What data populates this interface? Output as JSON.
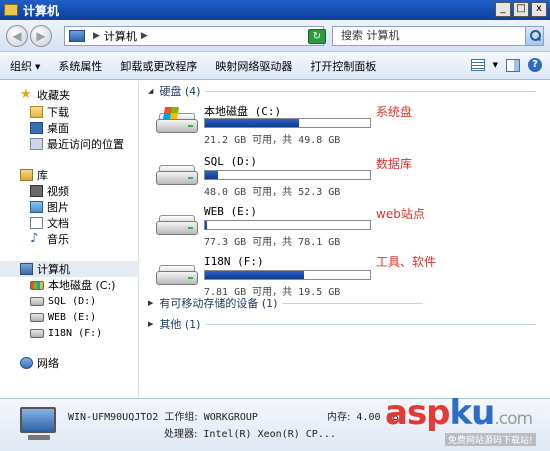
{
  "window": {
    "title": "计算机",
    "btn_min": "_",
    "btn_max": "□",
    "btn_close": "x"
  },
  "address": {
    "location": "计算机",
    "search_placeholder": "搜索 计算机"
  },
  "toolbar": {
    "organize": "组织",
    "system_properties": "系统属性",
    "uninstall": "卸载或更改程序",
    "map_drive": "映射网络驱动器",
    "control_panel": "打开控制面板"
  },
  "sidebar": {
    "favorites": "收藏夹",
    "downloads": "下载",
    "desktop": "桌面",
    "recent": "最近访问的位置",
    "libraries": "库",
    "videos": "视频",
    "pictures": "图片",
    "documents": "文档",
    "music": "音乐",
    "computer": "计算机",
    "drive_c": "本地磁盘 (C:)",
    "drive_d": "SQL (D:)",
    "drive_e": "WEB (E:)",
    "drive_f": "I18N (F:)",
    "network": "网络"
  },
  "groups": {
    "hdd": "硬盘 (4)",
    "removable": "有可移动存储的设备 (1)",
    "other": "其他 (1)"
  },
  "drives": [
    {
      "name": "本地磁盘 (C:)",
      "info": "21.2 GB 可用，共 49.8 GB",
      "used_fraction": 0.57,
      "annotation": "系统盘",
      "system": true
    },
    {
      "name": "SQL (D:)",
      "info": "48.0 GB 可用，共 52.3 GB",
      "used_fraction": 0.08,
      "annotation": "数据库",
      "system": false
    },
    {
      "name": "WEB (E:)",
      "info": "77.3 GB 可用，共 78.1 GB",
      "used_fraction": 0.01,
      "annotation": "web站点",
      "system": false
    },
    {
      "name": "I18N (F:)",
      "info": "7.81 GB 可用，共 19.5 GB",
      "used_fraction": 0.6,
      "annotation": "工具、软件",
      "system": false
    }
  ],
  "details": {
    "computer_name": "WIN-UFM90UQJTO2",
    "workgroup_label": "工作组:",
    "workgroup": "WORKGROUP",
    "memory_label": "内存:",
    "memory": "4.00 GB",
    "processor_label": "处理器:",
    "processor": "Intel(R) Xeon(R) CP..."
  },
  "watermark": {
    "brand_a": "asp",
    "brand_b": "ku",
    "brand_c": ".com",
    "tagline": "免费网站源码下载站!"
  }
}
